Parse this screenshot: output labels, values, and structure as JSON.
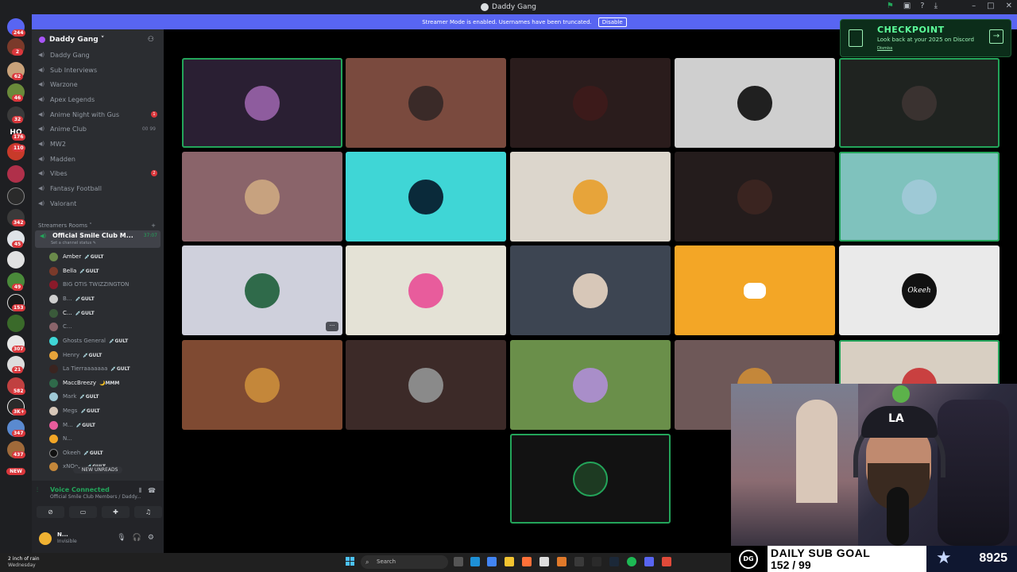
{
  "window": {
    "title": "Daddy Gang"
  },
  "banner": {
    "text": "Streamer Mode is enabled. Usernames have been truncated.",
    "disable_label": "Disable"
  },
  "guild_rail": {
    "badges": [
      "244",
      "2",
      "62",
      "46",
      "32",
      "110",
      "176",
      "342",
      "45",
      "49",
      "153",
      "307",
      "21",
      "582",
      "3K+",
      "347",
      "437"
    ],
    "home_label": "HO",
    "new_label": "NEW"
  },
  "server": {
    "name": "Daddy Gang ˅"
  },
  "channels": [
    {
      "name": "Daddy Gang",
      "badge": ""
    },
    {
      "name": "Sub Interviews",
      "badge": ""
    },
    {
      "name": "Warzone",
      "badge": ""
    },
    {
      "name": "Apex Legends",
      "badge": ""
    },
    {
      "name": "Anime Night with Gus",
      "badge": "1"
    },
    {
      "name": "Anime Club",
      "badge": "",
      "extra": "00  99"
    },
    {
      "name": "MW2",
      "badge": ""
    },
    {
      "name": "Madden",
      "badge": ""
    },
    {
      "name": "Vibes",
      "badge": "2"
    },
    {
      "name": "Fantasy Football",
      "badge": ""
    },
    {
      "name": "Valorant",
      "badge": ""
    }
  ],
  "category": {
    "name": "Streamers Rooms ˅",
    "plus": "+"
  },
  "active_channel": {
    "name": "Official Smile Club M...",
    "timer": "37:07",
    "status": "Set a channel status ✎"
  },
  "members": [
    {
      "name": "Amber",
      "tag": "💉GULT",
      "bright": true
    },
    {
      "name": "Bella",
      "tag": "💉GULT",
      "bright": true
    },
    {
      "name": "BIG OTIS TWIZZINGTON",
      "tag": "",
      "bright": false
    },
    {
      "name": "B...",
      "tag": "💉GULT",
      "bright": false
    },
    {
      "name": "C...",
      "tag": "💉GULT",
      "bright": true
    },
    {
      "name": "C...",
      "tag": "",
      "bright": false
    },
    {
      "name": "Ghosts General",
      "tag": "💉GULT",
      "bright": false
    },
    {
      "name": "Henry",
      "tag": "💉GULT",
      "bright": false
    },
    {
      "name": "La Tierraaaaaaa",
      "tag": "💉GULT",
      "bright": false
    },
    {
      "name": "MaccBreezy",
      "tag": "🌙MMM",
      "bright": true
    },
    {
      "name": "Mark",
      "tag": "💉GULT",
      "bright": false
    },
    {
      "name": "Megs",
      "tag": "💉GULT",
      "bright": false
    },
    {
      "name": "M...",
      "tag": "💉GULT",
      "bright": false
    },
    {
      "name": "N...",
      "tag": "",
      "bright": false
    },
    {
      "name": "Okeeh",
      "tag": "💉GULT",
      "bright": false
    },
    {
      "name": "xNOo...",
      "tag": "💉GULT",
      "bright": false
    }
  ],
  "new_unreads": "˅ NEW UNREADS",
  "voice": {
    "status": "Voice Connected",
    "channel": "Official Smile Club Members / Daddy..."
  },
  "user": {
    "name": "N...",
    "status": "Invisible"
  },
  "checkpoint": {
    "title": "CHECKPOINT",
    "subtitle": "Look back at your 2025 on Discord",
    "dismiss": "Dismiss"
  },
  "tiles": [
    {
      "bg": "#2a1f33",
      "avatar": "#8e5c9e",
      "speaking": true
    },
    {
      "bg": "#7a4a3e",
      "avatar": "#3a2a28",
      "speaking": false
    },
    {
      "bg": "#2a1c1c",
      "avatar": "#3c1a1a",
      "speaking": false
    },
    {
      "bg": "#cfcfcf",
      "avatar": "#202020",
      "speaking": false
    },
    {
      "bg": "#1f2320",
      "avatar": "#3a3230",
      "speaking": true
    },
    {
      "bg": "#8a646a",
      "avatar": "#c7a27f",
      "speaking": false
    },
    {
      "bg": "#3fd6d6",
      "avatar": "#0a2a3a",
      "speaking": false
    },
    {
      "bg": "#dcd6cc",
      "avatar": "#e7a43a",
      "speaking": false
    },
    {
      "bg": "#241c1c",
      "avatar": "#3a2420",
      "speaking": false
    },
    {
      "bg": "#7fc2bd",
      "avatar": "#9ec9d6",
      "speaking": true
    },
    {
      "bg": "#cfd0dc",
      "avatar": "#2f6a4a",
      "speaking": false
    },
    {
      "bg": "#e4e2d6",
      "avatar": "#e85c9c",
      "speaking": false
    },
    {
      "bg": "#3d4552",
      "avatar": "#d7c7b8",
      "speaking": false
    },
    {
      "bg": "#f3a626",
      "avatar": "#f3a626",
      "speaking": false
    },
    {
      "bg": "#eaeaea",
      "avatar": "#111111",
      "speaking": false
    },
    {
      "bg": "#7f4a32",
      "avatar": "#c4873a",
      "speaking": false
    },
    {
      "bg": "#3c2a28",
      "avatar": "#8a8a8a",
      "speaking": false
    },
    {
      "bg": "#6a8f4a",
      "avatar": "#a98ec9",
      "speaking": false
    },
    {
      "bg": "#6e5858",
      "avatar": "#c4873a",
      "speaking": false
    },
    {
      "bg": "#d8cfc2",
      "avatar": "#c94040",
      "speaking": true
    },
    {
      "bg": "#121212",
      "avatar": "#1d3a22",
      "speaking": true
    }
  ],
  "tile_labels": {
    "okeeh": "Okeeh",
    "more": "···"
  },
  "sub_goal": {
    "title": "DAILY SUB GOAL",
    "count": "152 / 99",
    "total": "8925",
    "logo": "DG"
  },
  "taskbar": {
    "weather_line1": "2 inch of rain",
    "weather_line2": "Wednesday",
    "search_label": "Search"
  }
}
